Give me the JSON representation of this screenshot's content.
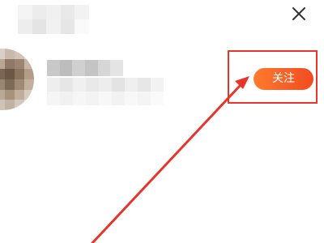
{
  "dialog": {
    "close_icon": "close-icon"
  },
  "user": {
    "follow_button_label": "关注"
  },
  "annotation": {
    "highlight_color": "#e8342a",
    "arrow_color": "#e8342a"
  },
  "colors": {
    "button_start": "#ff7a2e",
    "button_end": "#f24c21"
  }
}
